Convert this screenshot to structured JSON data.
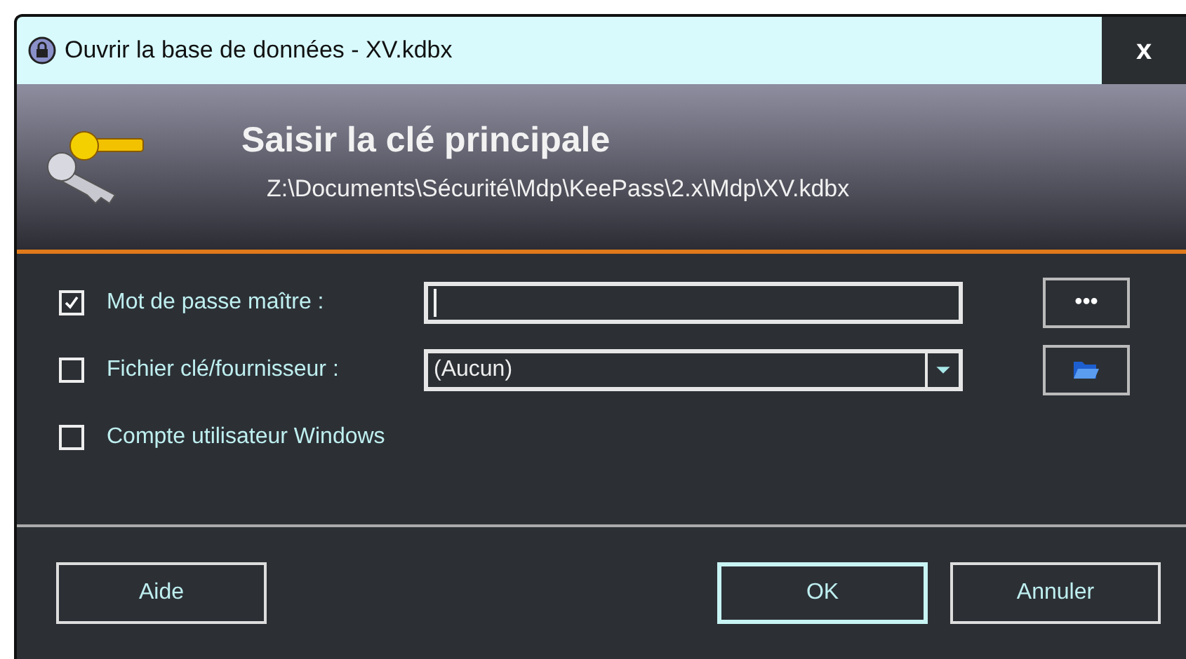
{
  "window": {
    "title": "Ouvrir la base de données - XV.kdbx",
    "close": "x"
  },
  "header": {
    "title": "Saisir la clé principale",
    "path": "Z:\\Documents\\Sécurité\\Mdp\\KeePass\\2.x\\Mdp\\XV.kdbx"
  },
  "options": [
    {
      "kind": "password",
      "label": "Mot de passe maître :",
      "checked": true,
      "side_button": "•••"
    },
    {
      "kind": "file",
      "label": "Fichier clé/fournisseur :",
      "checked": false,
      "value": "(Aucun)"
    },
    {
      "kind": "account",
      "label": "Compte utilisateur Windows",
      "checked": false
    }
  ],
  "buttons": [
    {
      "label": "Aide",
      "default": false
    },
    {
      "label": "OK",
      "default": true
    },
    {
      "label": "Annuler",
      "default": false
    }
  ]
}
